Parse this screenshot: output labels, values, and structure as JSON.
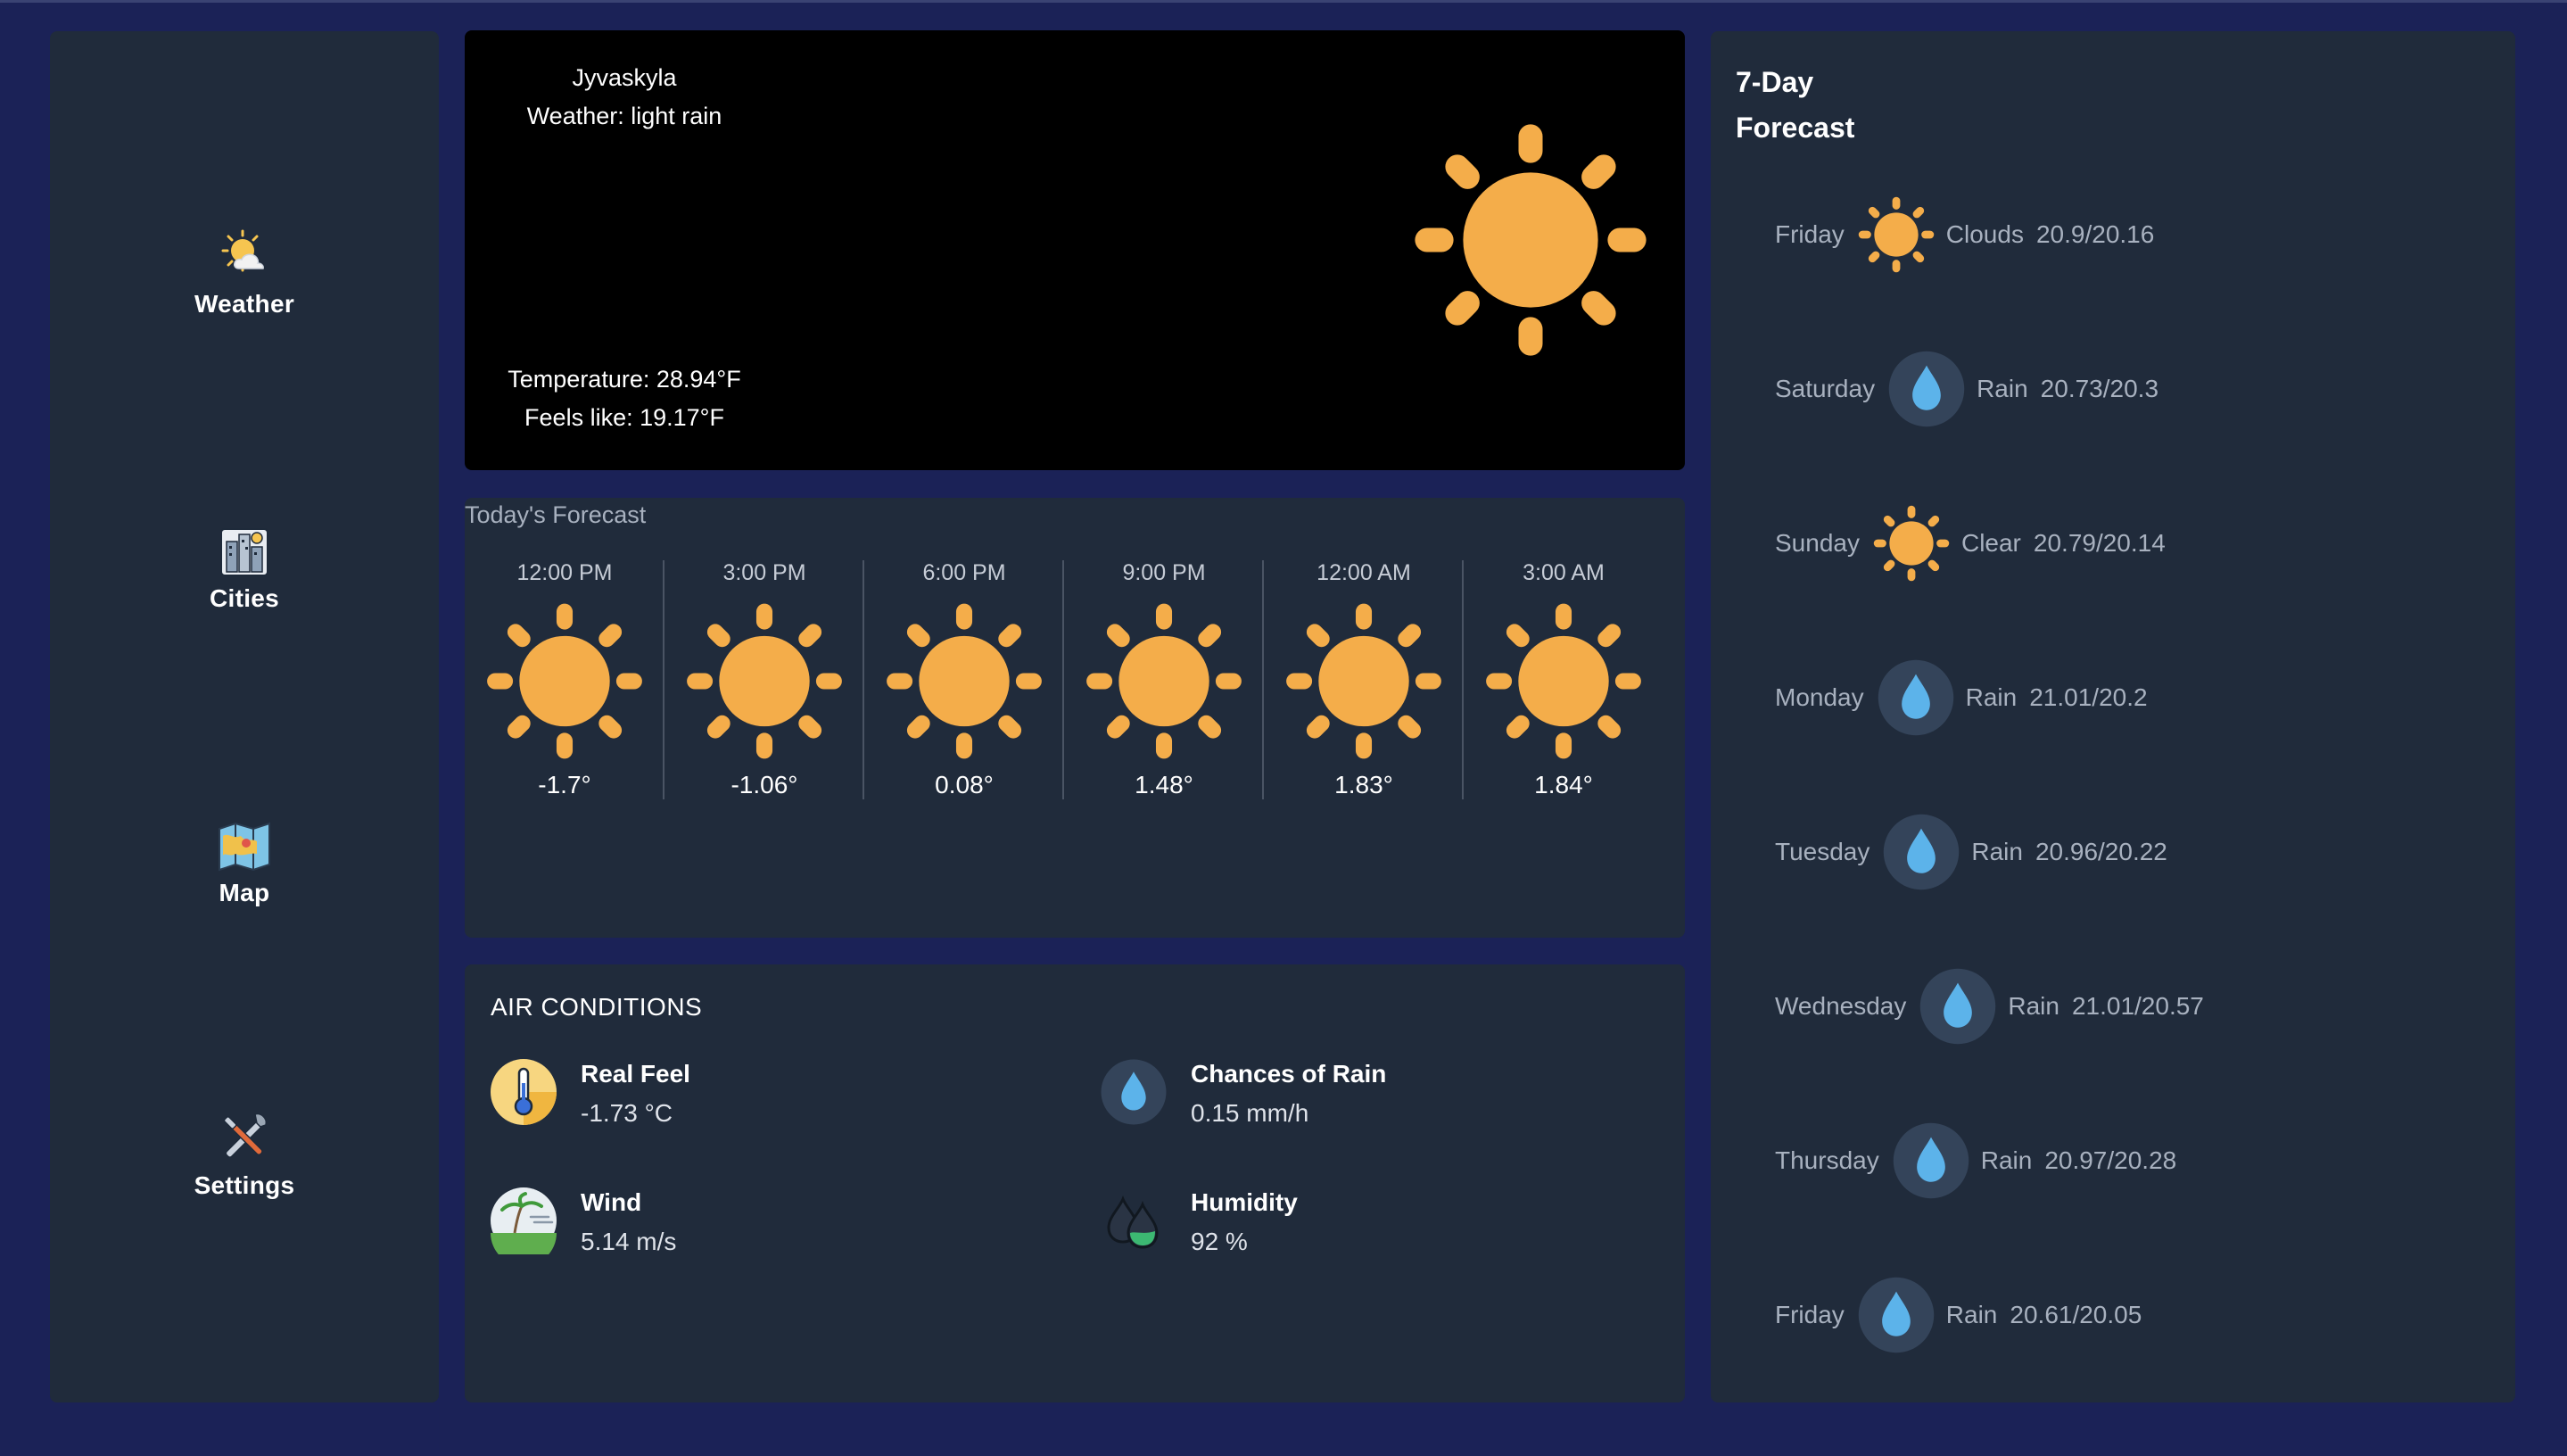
{
  "sidebar": {
    "items": [
      {
        "label": "Weather",
        "icon": "weather-icon"
      },
      {
        "label": "Cities",
        "icon": "cities-icon"
      },
      {
        "label": "Map",
        "icon": "map-icon"
      },
      {
        "label": "Settings",
        "icon": "settings-icon"
      }
    ]
  },
  "current": {
    "city": "Jyvaskyla",
    "weather": "Weather: light rain",
    "temperature": "Temperature: 28.94°F",
    "feels_like": "Feels like: 19.17°F",
    "icon": "sun-icon"
  },
  "today": {
    "title": "Today's Forecast",
    "hours": [
      {
        "time": "12:00 PM",
        "temp": "-1.7°",
        "icon": "sun-icon"
      },
      {
        "time": "3:00 PM",
        "temp": "-1.06°",
        "icon": "sun-icon"
      },
      {
        "time": "6:00 PM",
        "temp": "0.08°",
        "icon": "sun-icon"
      },
      {
        "time": "9:00 PM",
        "temp": "1.48°",
        "icon": "sun-icon"
      },
      {
        "time": "12:00 AM",
        "temp": "1.83°",
        "icon": "sun-icon"
      },
      {
        "time": "3:00 AM",
        "temp": "1.84°",
        "icon": "sun-icon"
      }
    ]
  },
  "air": {
    "title": "AIR CONDITIONS",
    "real_feel": {
      "label": "Real Feel",
      "value": "-1.73 °C",
      "icon": "thermometer-icon"
    },
    "rain": {
      "label": "Chances of Rain",
      "value": "0.15 mm/h",
      "icon": "raindrop-icon"
    },
    "wind": {
      "label": "Wind",
      "value": "5.14 m/s",
      "icon": "wind-icon"
    },
    "humidity": {
      "label": "Humidity",
      "value": "92 %",
      "icon": "humidity-icon"
    }
  },
  "week": {
    "title_line1": "7-Day",
    "title_line2": "Forecast",
    "days": [
      {
        "day": "Friday",
        "condition": "Clouds",
        "temps": "20.9/20.16",
        "icon": "sun-icon"
      },
      {
        "day": "Saturday",
        "condition": "Rain",
        "temps": "20.73/20.3",
        "icon": "raindrop-icon"
      },
      {
        "day": "Sunday",
        "condition": "Clear",
        "temps": "20.79/20.14",
        "icon": "sun-icon"
      },
      {
        "day": "Monday",
        "condition": "Rain",
        "temps": "21.01/20.2",
        "icon": "raindrop-icon"
      },
      {
        "day": "Tuesday",
        "condition": "Rain",
        "temps": "20.96/20.22",
        "icon": "raindrop-icon"
      },
      {
        "day": "Wednesday",
        "condition": "Rain",
        "temps": "21.01/20.57",
        "icon": "raindrop-icon"
      },
      {
        "day": "Thursday",
        "condition": "Rain",
        "temps": "20.97/20.28",
        "icon": "raindrop-icon"
      },
      {
        "day": "Friday",
        "condition": "Rain",
        "temps": "20.61/20.05",
        "icon": "raindrop-icon"
      }
    ]
  },
  "colors": {
    "page_bg": "#1b2257",
    "panel_bg": "#202b3b",
    "sun": "#f4ad4a",
    "drop": "#5cb3ea",
    "drop_bg": "#34445a",
    "muted_text": "#a8b1bf"
  }
}
